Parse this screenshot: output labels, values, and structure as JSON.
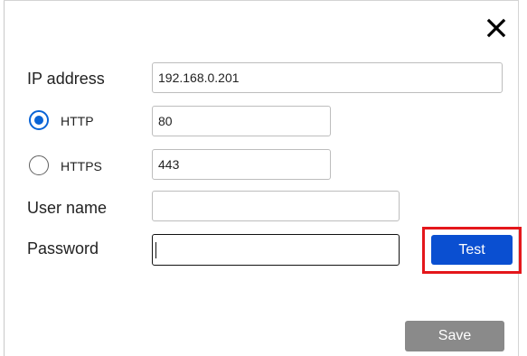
{
  "dialog": {
    "close_icon": "close-icon"
  },
  "form": {
    "ip_address": {
      "label": "IP address",
      "value": "192.168.0.201"
    },
    "http": {
      "label": "HTTP",
      "port": "80",
      "selected": true
    },
    "https": {
      "label": "HTTPS",
      "port": "443",
      "selected": false
    },
    "user_name": {
      "label": "User name",
      "value": ""
    },
    "password": {
      "label": "Password",
      "value": ""
    }
  },
  "buttons": {
    "test_label": "Test",
    "save_label": "Save"
  },
  "colors": {
    "accent": "#0a4fd1",
    "radio_selected": "#0a64d6",
    "highlight": "#e4161b",
    "save_disabled": "#8a8a8a"
  }
}
